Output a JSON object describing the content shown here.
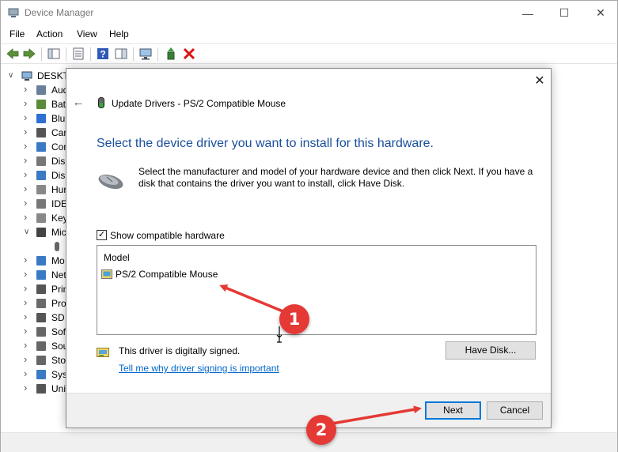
{
  "window": {
    "title": "Device Manager",
    "controls": {
      "minimize": "—",
      "maximize": "☐",
      "close": "✕"
    }
  },
  "menu": [
    "File",
    "Action",
    "View",
    "Help"
  ],
  "tree": {
    "root_label": "DESKTO",
    "items": [
      {
        "label": "Aud",
        "icon": "speaker-icon",
        "expanded": false
      },
      {
        "label": "Bat",
        "icon": "battery-icon",
        "expanded": false
      },
      {
        "label": "Blu",
        "icon": "bluetooth-icon",
        "expanded": false
      },
      {
        "label": "Car",
        "icon": "camera-icon",
        "expanded": false
      },
      {
        "label": "Cor",
        "icon": "computer-icon",
        "expanded": false
      },
      {
        "label": "Disl",
        "icon": "disk-drive-icon",
        "expanded": false
      },
      {
        "label": "Disp",
        "icon": "display-adapter-icon",
        "expanded": false
      },
      {
        "label": "Hur",
        "icon": "hid-icon",
        "expanded": false
      },
      {
        "label": "IDE",
        "icon": "ide-icon",
        "expanded": false
      },
      {
        "label": "Key",
        "icon": "keyboard-icon",
        "expanded": false
      },
      {
        "label": "Mic",
        "icon": "mouse-icon",
        "expanded": true
      },
      {
        "label": "",
        "icon": "mouse-device-icon",
        "expanded": null
      },
      {
        "label": "Mo",
        "icon": "monitor-icon",
        "expanded": false
      },
      {
        "label": "Net",
        "icon": "network-icon",
        "expanded": false
      },
      {
        "label": "Prin",
        "icon": "printer-icon",
        "expanded": false
      },
      {
        "label": "Pro",
        "icon": "processor-icon",
        "expanded": false
      },
      {
        "label": "SD",
        "icon": "sd-card-icon",
        "expanded": false
      },
      {
        "label": "Sof",
        "icon": "software-device-icon",
        "expanded": false
      },
      {
        "label": "Sou",
        "icon": "sound-icon",
        "expanded": false
      },
      {
        "label": "Sto",
        "icon": "storage-icon",
        "expanded": false
      },
      {
        "label": "Sys",
        "icon": "system-icon",
        "expanded": false
      },
      {
        "label": "Uni",
        "icon": "usb-icon",
        "expanded": false
      }
    ]
  },
  "dialog": {
    "back_glyph": "←",
    "close_glyph": "✕",
    "title": "Update Drivers - PS/2 Compatible Mouse",
    "heading": "Select the device driver you want to install for this hardware.",
    "description": "Select the manufacturer and model of your hardware device and then click Next. If you have a disk that contains the driver you want to install, click Have Disk.",
    "show_compatible_label": "Show compatible hardware",
    "show_compatible_checked": true,
    "checkmark": "✓",
    "model_header": "Model",
    "models": [
      "PS/2 Compatible Mouse"
    ],
    "signed_text": "This driver is digitally signed.",
    "signing_link": "Tell me why driver signing is important",
    "have_disk_label": "Have Disk...",
    "next_label": "Next",
    "cancel_label": "Cancel"
  },
  "annotations": {
    "badge_1": "1",
    "badge_2": "2",
    "arrow_color": "#e53935"
  }
}
